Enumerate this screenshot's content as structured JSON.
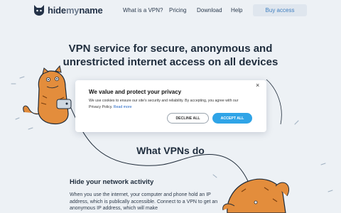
{
  "brand": {
    "name_part1": "hide",
    "name_part2": "my",
    "name_part3": "name",
    "accent_color": "#2fa4e7"
  },
  "nav": {
    "items": [
      {
        "label": "What is a VPN?"
      },
      {
        "label": "Pricing"
      },
      {
        "label": "Download"
      },
      {
        "label": "Help"
      }
    ],
    "buy_label": "Buy access"
  },
  "hero": {
    "line1": "VPN service for secure, anonymous and",
    "line2": "unrestricted internet access on all devices"
  },
  "section": {
    "title": "What VPNs do",
    "feature_heading": "Hide your network activity",
    "feature_body": "When you use the internet, your computer and phone hold an IP address, which is publically accessible. Connect to a VPN to get an anonymous IP address, which will make"
  },
  "cookie_modal": {
    "title": "We value and protect your privacy",
    "text": "We use cookies to ensure our site's security and reliability. By accepting, you agree with our Privacy Policy.",
    "link": "Read more",
    "decline": "DECLINE ALL",
    "accept": "ACCEPT ALL",
    "close_glyph": "×"
  },
  "icons": {
    "logo": "cat-face-icon",
    "close": "close-icon"
  }
}
